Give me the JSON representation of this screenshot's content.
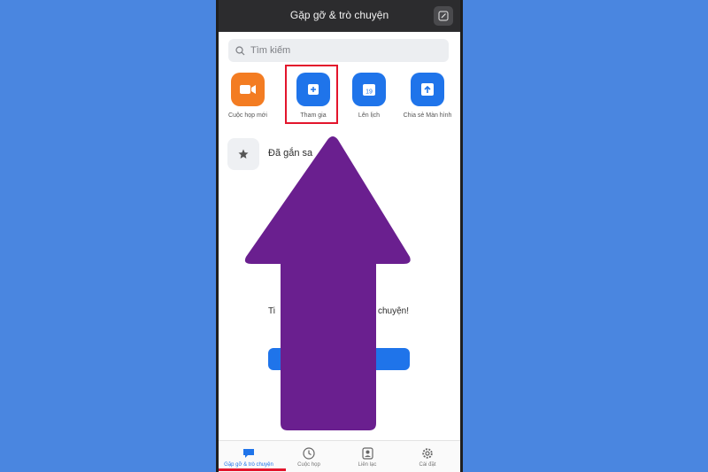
{
  "header": {
    "title": "Gặp gỡ & trò chuyện",
    "edit_icon": "edit-icon"
  },
  "search": {
    "placeholder": "Tìm kiếm"
  },
  "actions": [
    {
      "label": "Cuộc họp mới",
      "icon": "video-camera-icon",
      "color": "#f37c22"
    },
    {
      "label": "Tham gia",
      "icon": "plus-icon",
      "color": "#1f74ea"
    },
    {
      "label": "Lên lịch",
      "icon": "calendar-icon",
      "color": "#1f74ea",
      "day": "19"
    },
    {
      "label": "Chia sẻ Màn hình",
      "icon": "share-screen-icon",
      "color": "#1f74ea"
    }
  ],
  "starred": {
    "label": "Đã gắn sa",
    "icon": "star-icon"
  },
  "empty_state": {
    "text_left": "Ti",
    "text_right": "chuyện!"
  },
  "tabs": [
    {
      "label": "Gặp gỡ & trò chuyện",
      "icon": "chat-icon",
      "active": true
    },
    {
      "label": "Cuộc họp",
      "icon": "clock-icon",
      "active": false
    },
    {
      "label": "Liên lạc",
      "icon": "contacts-icon",
      "active": false
    },
    {
      "label": "Cài đặt",
      "icon": "gear-icon",
      "active": false
    }
  ],
  "colors": {
    "background": "#4a86e0",
    "accent": "#1f74ea",
    "highlight": "#e3152c",
    "arrow": "#6a1f8f"
  }
}
